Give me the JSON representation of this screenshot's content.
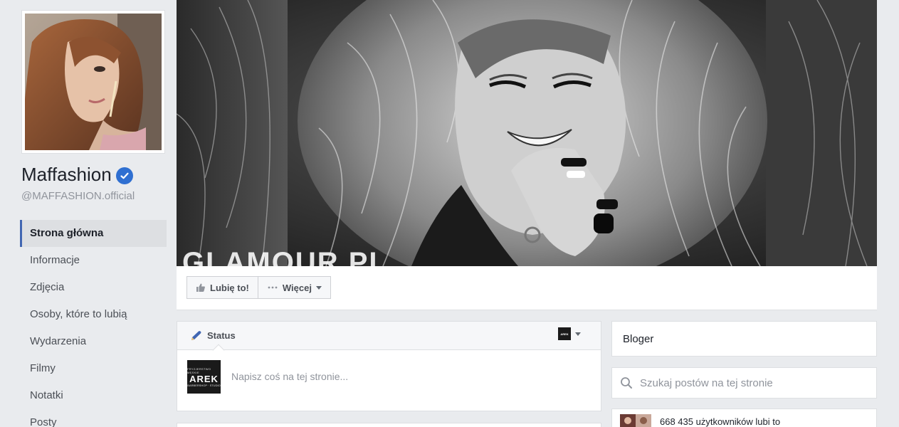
{
  "profile": {
    "name": "Maffashion",
    "handle": "@MAFFASHION.official",
    "verified_icon": "verified-badge-icon"
  },
  "nav": {
    "items": [
      {
        "label": "Strona główna",
        "active": true
      },
      {
        "label": "Informacje"
      },
      {
        "label": "Zdjęcia"
      },
      {
        "label": "Osoby, które to lubią"
      },
      {
        "label": "Wydarzenia"
      },
      {
        "label": "Filmy"
      },
      {
        "label": "Notatki"
      },
      {
        "label": "Posty"
      }
    ]
  },
  "cover": {
    "watermark": "GLAMOUR.PL"
  },
  "actions": {
    "like_label": "Lubię to!",
    "like_icon": "thumbs-up-icon",
    "more_label": "Więcej",
    "more_icon": "ellipsis-icon"
  },
  "composer": {
    "tab_label": "Status",
    "tab_icon": "pencil-icon",
    "placeholder": "Napisz coś na tej stronie...",
    "avatar_top": "FRYZJERSTWO MĘSKIE",
    "avatar_name": "AREK",
    "avatar_bottom": "BARBERSHOP · STUDIO",
    "selector_avatar": "AREK"
  },
  "sidebar": {
    "category": "Bloger",
    "search_placeholder": "Szukaj postów na tej stronie",
    "likes_text": "668 435 użytkowników lubi to"
  },
  "colors": {
    "background": "#e9ebee",
    "accent": "#4267b2",
    "verified": "#2f6fd1"
  }
}
